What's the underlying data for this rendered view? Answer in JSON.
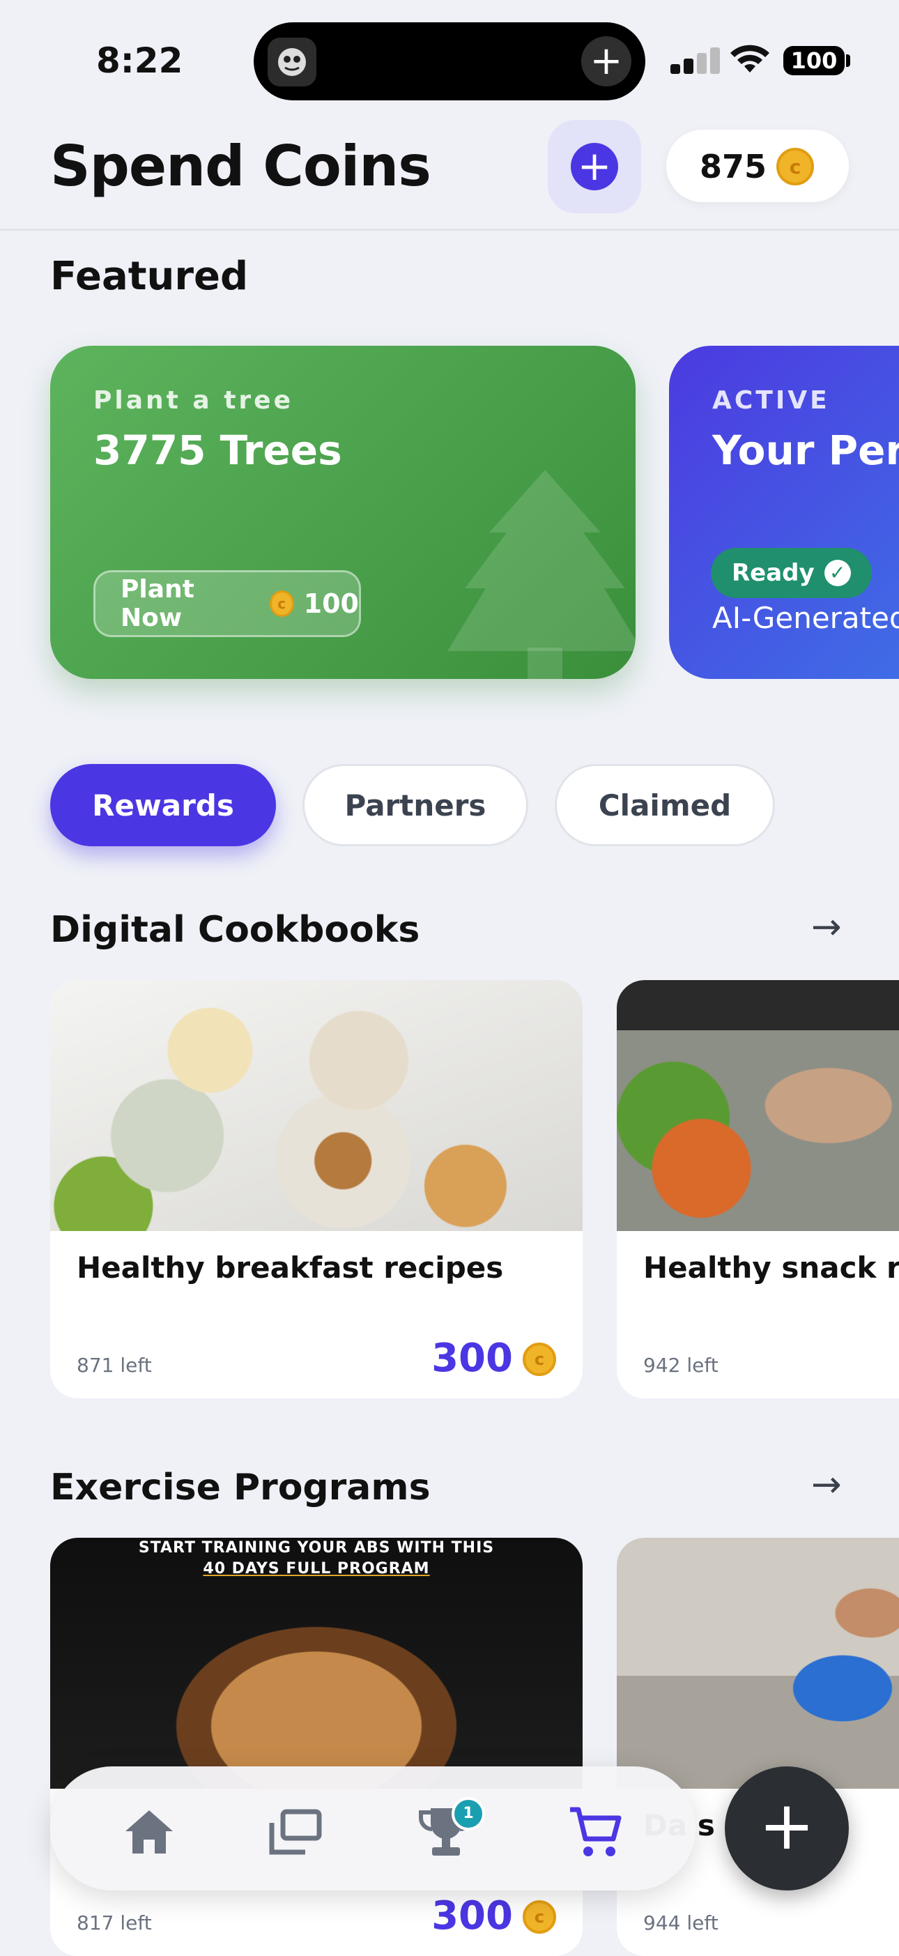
{
  "status_bar": {
    "time": "8:22",
    "battery": "100"
  },
  "header": {
    "title": "Spend Coins",
    "coin_balance": "875"
  },
  "featured": {
    "heading": "Featured",
    "cards": [
      {
        "kicker": "Plant a tree",
        "title": "3775 Trees",
        "button_label": "Plant Now",
        "price": "100"
      },
      {
        "kicker": "ACTIVE",
        "title": "Your Perso",
        "badge": "Ready",
        "subtitle": "AI-Generated"
      }
    ]
  },
  "tabs": [
    "Rewards",
    "Partners",
    "Claimed"
  ],
  "sections": [
    {
      "heading": "Digital Cookbooks",
      "items": [
        {
          "name": "Healthy breakfast recipes",
          "left": "871 left",
          "price": "300"
        },
        {
          "name": "Healthy snack rec",
          "left": "942 left",
          "price": ""
        }
      ]
    },
    {
      "heading": "Exercise Programs",
      "items": [
        {
          "name": "",
          "left": "817 left",
          "price": "300",
          "promo_line1": "START TRAINING YOUR ABS WITH THIS",
          "promo_line2": "40 DAYS FULL PROGRAM"
        },
        {
          "name": "Da     s Pr",
          "left": "944 left",
          "price": ""
        }
      ]
    }
  ],
  "nav": {
    "trophy_badge": "1"
  },
  "colors": {
    "accent": "#4b36e3",
    "green_card": "#4caf50",
    "coin": "#f0b429",
    "ready": "#1f8f6e"
  }
}
